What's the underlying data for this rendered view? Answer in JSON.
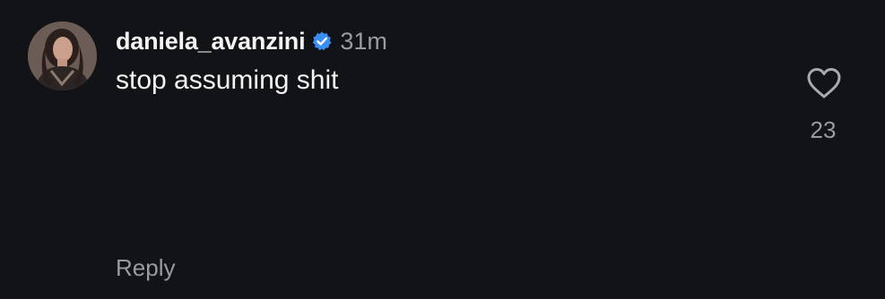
{
  "comment": {
    "username": "daniela_avanzini",
    "verified": true,
    "time": "31m",
    "text": "stop assuming shit",
    "like_count": "23",
    "reply_label": "Reply",
    "icons": {
      "avatar": "user-avatar-photo",
      "verified": "verified-badge-icon",
      "like": "heart-outline-icon"
    },
    "colors": {
      "background": "#121317",
      "primary_text": "#f4f4f6",
      "secondary_text": "#9a9ba0",
      "verified": "#3a8ef6"
    }
  }
}
